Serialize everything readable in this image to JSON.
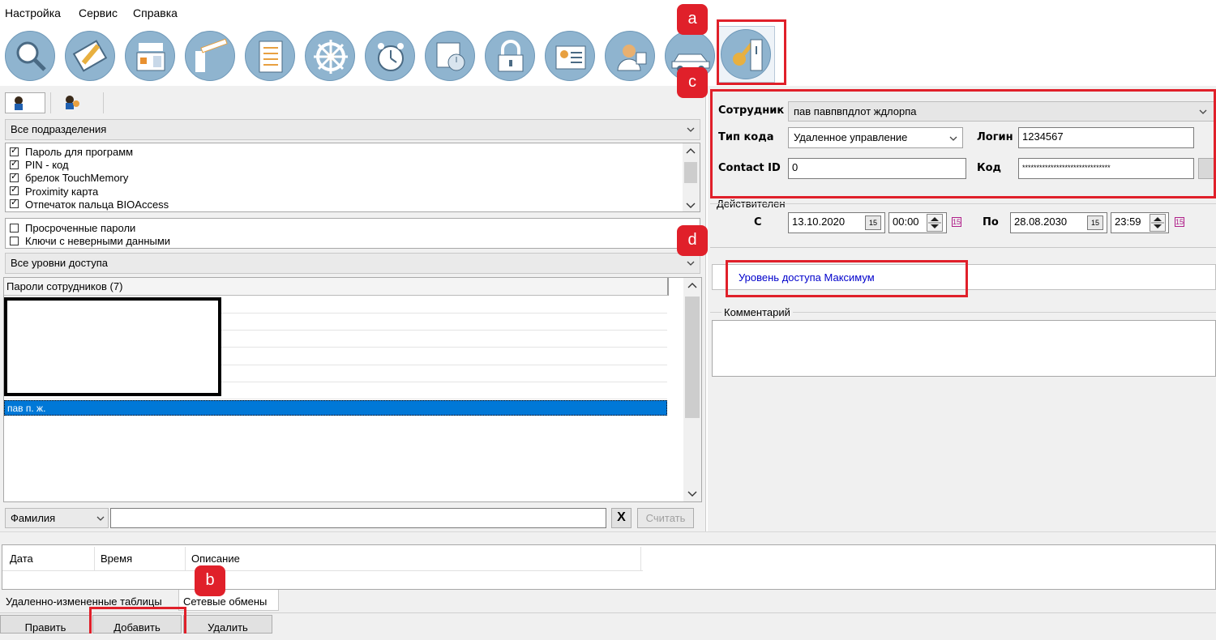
{
  "menu": {
    "items": [
      "Настройка",
      "Сервис",
      "Справка"
    ]
  },
  "toolbar": {
    "icons": [
      "search-icon",
      "card-edit-icon",
      "controller-device-icon",
      "barrier-gate-icon",
      "document-list-icon",
      "helm-wheel-icon",
      "alarm-clock-icon",
      "schedule-clock-icon",
      "padlock-icon",
      "id-card-icon",
      "employee-icon",
      "car-icon",
      "key-icon"
    ]
  },
  "left": {
    "filter_department": "Все подразделения",
    "key_types": [
      {
        "label": "Пароль для программ",
        "checked": true
      },
      {
        "label": "PIN - код",
        "checked": true
      },
      {
        "label": "брелок TouchMemory",
        "checked": true
      },
      {
        "label": "Proximity карта",
        "checked": true
      },
      {
        "label": "Отпечаток пальца BIOAccess",
        "checked": true
      }
    ],
    "extra_filters": [
      {
        "label": "Просроченные пароли",
        "checked": false
      },
      {
        "label": "Ключи с неверными данными",
        "checked": false
      }
    ],
    "filter_access": "Все уровни доступа",
    "list_header": "Пароли сотрудников  (7)",
    "selected_row": "пав п. ж.",
    "search_field": "Фамилия",
    "search_value": "",
    "clear_label": "X",
    "read_button": "Считать"
  },
  "right": {
    "employee_label": "Сотрудник",
    "employee_value": "пав павпвпдлот ждлорпа",
    "code_type_label": "Тип кода",
    "code_type_value": "Удаленное управление",
    "login_label": "Логин",
    "login_value": "1234567",
    "contact_label": "Contact ID",
    "contact_value": "0",
    "code_label": "Код",
    "code_value": "*******************************",
    "valid_label": "Действителен",
    "from_label": "С",
    "from_date": "13.10.2020",
    "from_time": "00:00",
    "to_label": "По",
    "to_date": "28.08.2030",
    "to_time": "23:59",
    "cal_glyph": "15",
    "access_level": "Уровень доступа  Максимум",
    "comment_label": "Комментарий",
    "comment_value": ""
  },
  "log": {
    "columns": [
      "Дата",
      "Время",
      "Описание"
    ],
    "tabs": [
      "Удаленно-измененные таблицы",
      "Сетевые обмены"
    ]
  },
  "bottom_buttons": [
    "Править",
    "Добавить",
    "Удалить"
  ],
  "annotations": [
    "a",
    "b",
    "c",
    "d"
  ],
  "colors": {
    "accent_red": "#e0202a",
    "selection": "#0078d7",
    "link_blue": "#0000cc"
  }
}
